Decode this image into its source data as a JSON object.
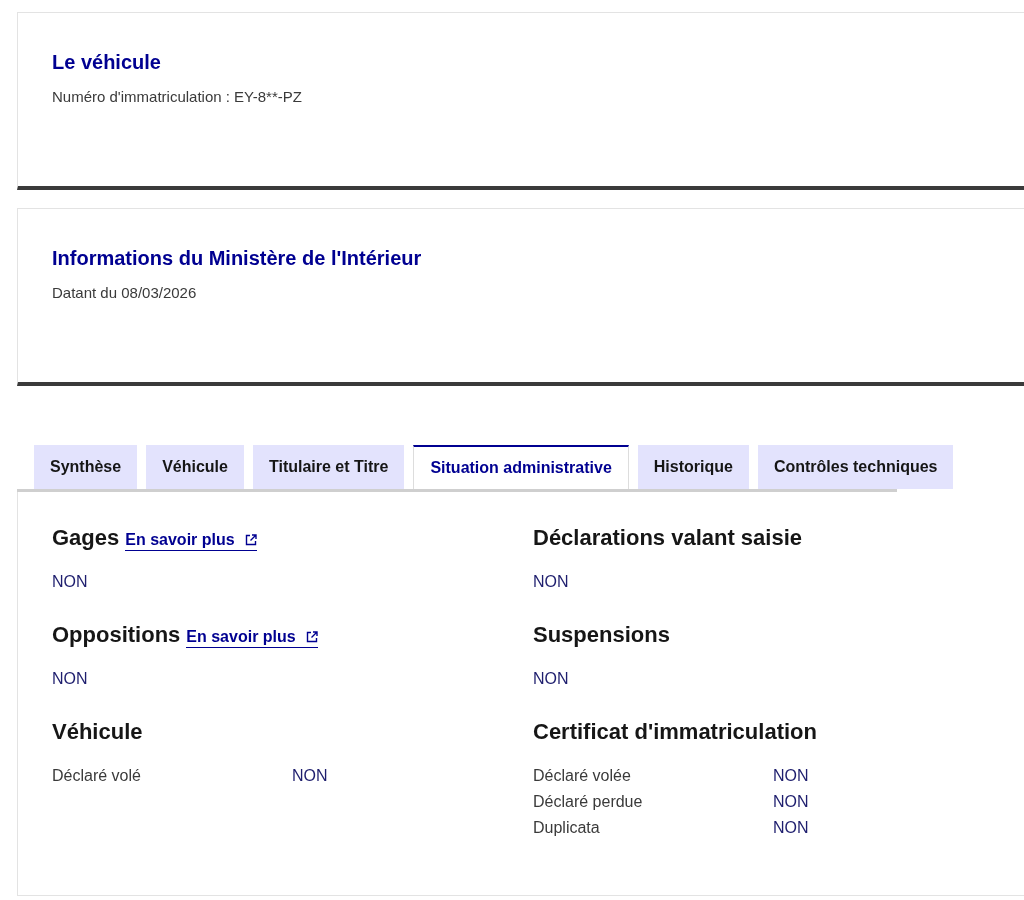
{
  "cards": [
    {
      "title": "Le véhicule",
      "subtitle": "Numéro d'immatriculation : EY-8**-PZ"
    },
    {
      "title": "Informations du Ministère de l'Intérieur",
      "subtitle": "Datant du 08/03/2026"
    }
  ],
  "tabs": [
    {
      "label": "Synthèse",
      "selected": false
    },
    {
      "label": "Véhicule",
      "selected": false
    },
    {
      "label": "Titulaire et Titre",
      "selected": false
    },
    {
      "label": "Situation administrative",
      "selected": true
    },
    {
      "label": "Historique",
      "selected": false
    },
    {
      "label": "Contrôles techniques",
      "selected": false
    }
  ],
  "panel": {
    "sections": [
      {
        "kind": "status",
        "heading": "Gages",
        "link": "En savoir plus",
        "value": "NON"
      },
      {
        "kind": "status",
        "heading": "Déclarations valant saisie",
        "value": "NON"
      },
      {
        "kind": "status",
        "heading": "Oppositions",
        "link": "En savoir plus",
        "value": "NON"
      },
      {
        "kind": "status",
        "heading": "Suspensions",
        "value": "NON"
      },
      {
        "kind": "table",
        "heading": "Véhicule",
        "rows": [
          {
            "label": "Déclaré volé",
            "value": "NON"
          }
        ]
      },
      {
        "kind": "table",
        "heading": "Certificat d'immatriculation",
        "rows": [
          {
            "label": "Déclaré volée",
            "value": "NON"
          },
          {
            "label": "Déclaré perdue",
            "value": "NON"
          },
          {
            "label": "Duplicata",
            "value": "NON"
          }
        ]
      }
    ]
  }
}
